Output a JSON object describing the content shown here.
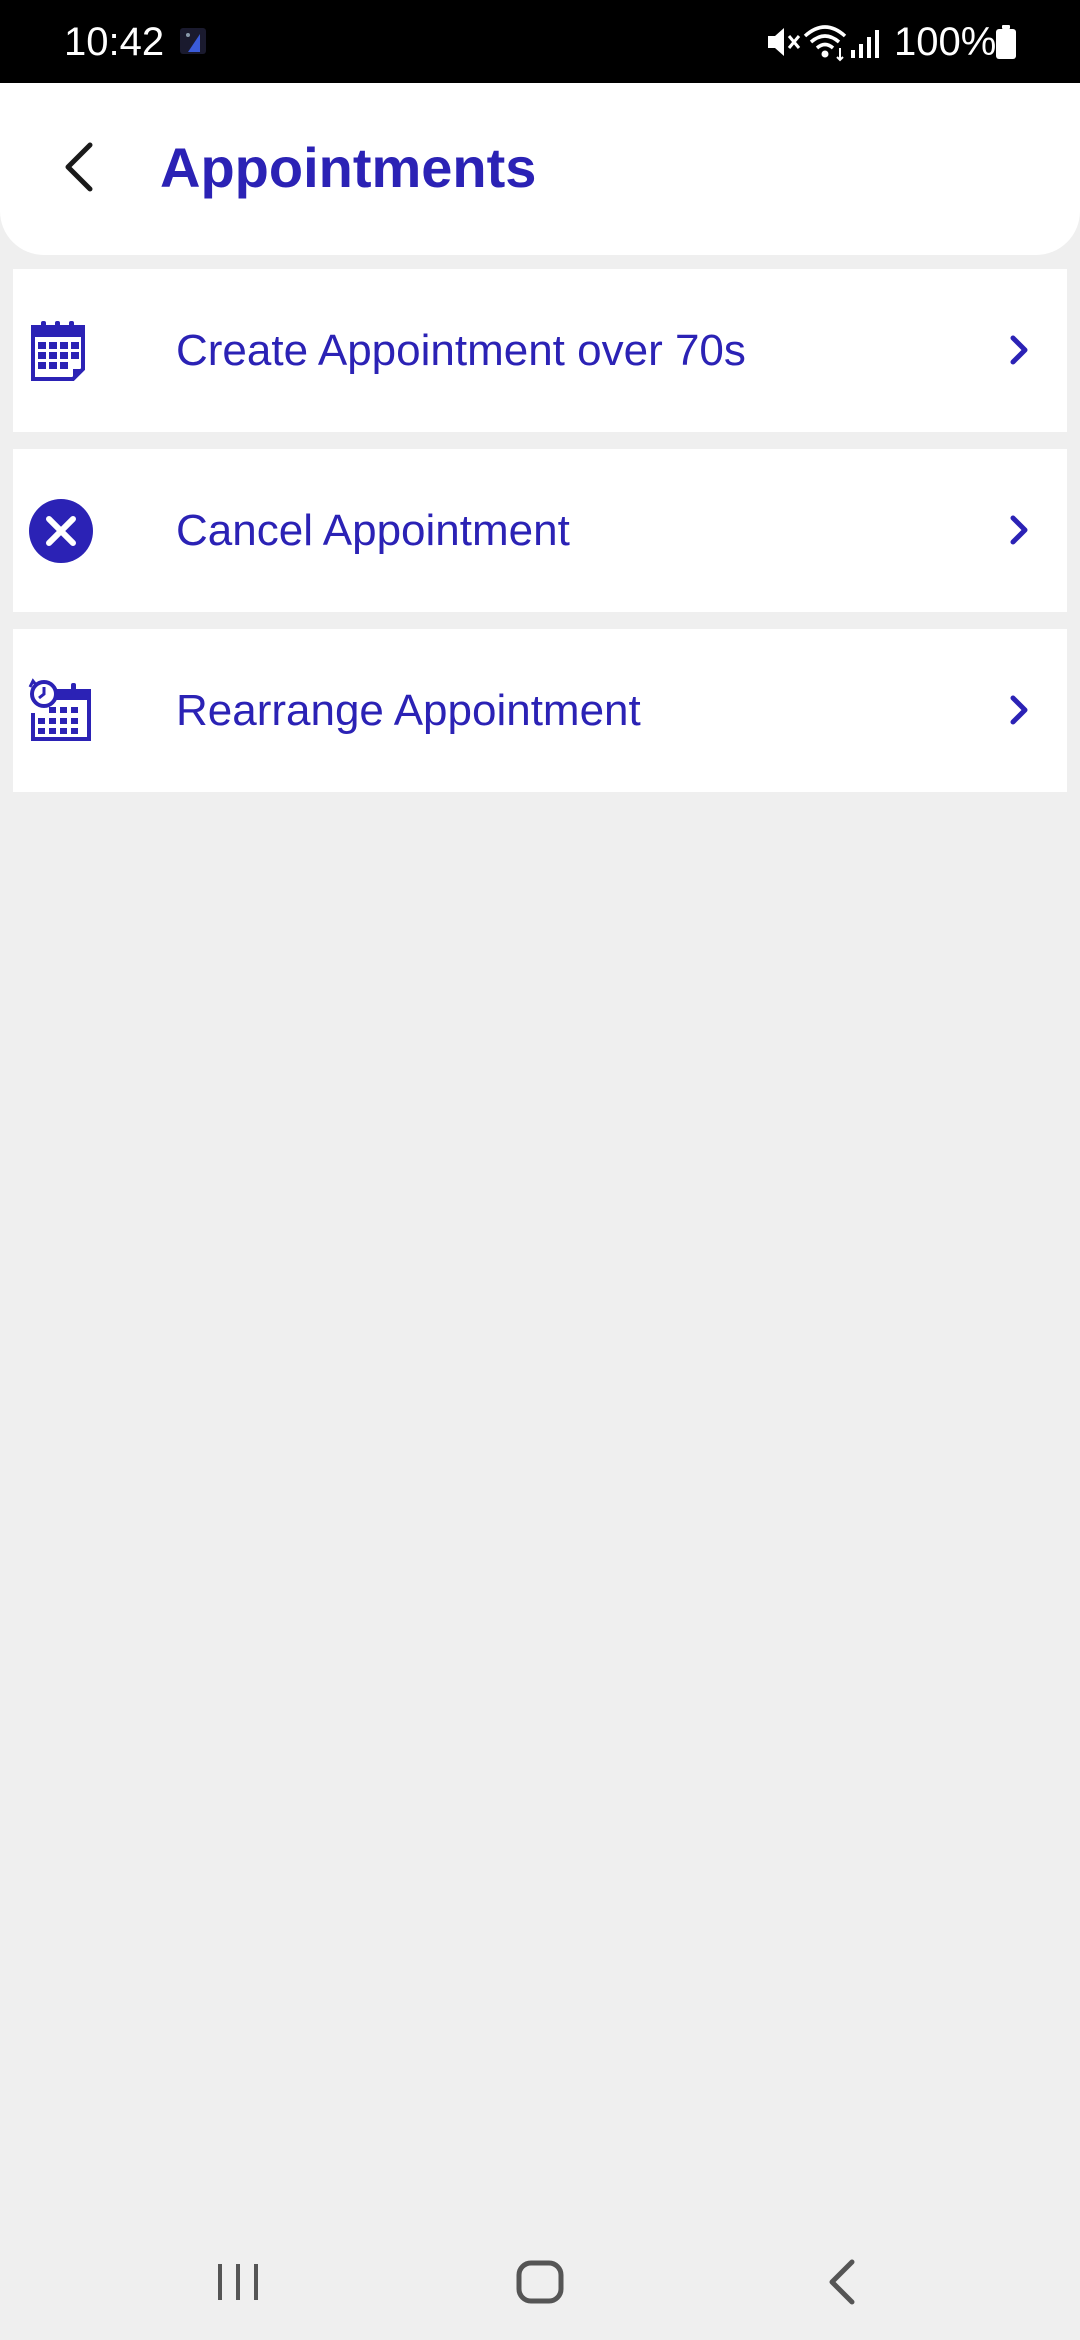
{
  "status_bar": {
    "time": "10:42",
    "battery_text": "100%",
    "icons": [
      "app-notification-icon",
      "mute-icon",
      "wifi-icon",
      "signal-icon",
      "battery-icon"
    ]
  },
  "header": {
    "title": "Appointments",
    "back_icon": "chevron-left-icon"
  },
  "menu": {
    "items": [
      {
        "label": "Create Appointment over 70s",
        "icon": "calendar-icon"
      },
      {
        "label": "Cancel Appointment",
        "icon": "cancel-circle-icon"
      },
      {
        "label": "Rearrange Appointment",
        "icon": "calendar-clock-icon"
      }
    ],
    "chevron_icon": "chevron-right-icon"
  },
  "nav_bar": {
    "icons": [
      "recents-icon",
      "home-icon",
      "back-icon"
    ]
  },
  "colors": {
    "accent": "#2b22b5",
    "background": "#efefef",
    "card": "#ffffff",
    "status_bar": "#000000"
  }
}
